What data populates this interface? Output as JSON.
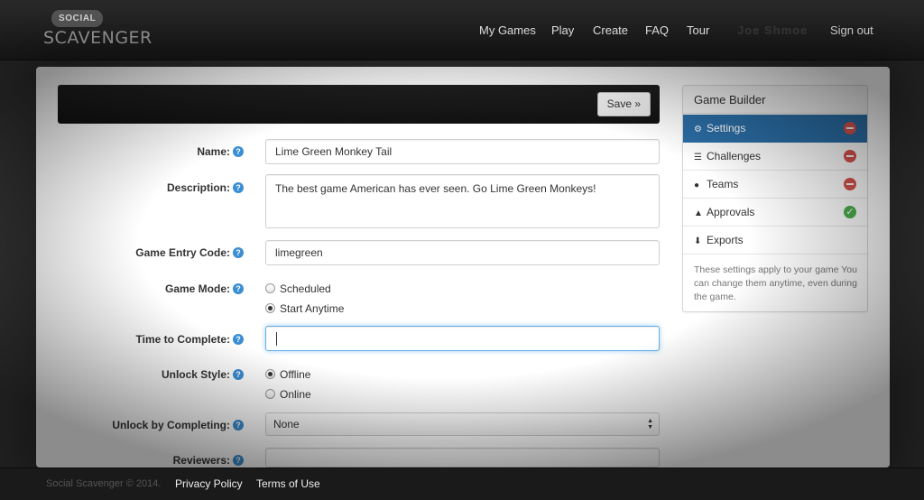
{
  "brand": {
    "social": "SOCIAL",
    "scavenger": "SCAVENGER"
  },
  "nav": {
    "items": [
      {
        "label": "My Games"
      },
      {
        "label": "Play"
      },
      {
        "label": "Create"
      },
      {
        "label": "FAQ"
      },
      {
        "label": "Tour"
      }
    ],
    "user": "Joe Shmoe",
    "signout": "Sign out"
  },
  "toolbar": {
    "save_label": "Save »"
  },
  "form": {
    "name": {
      "label": "Name:",
      "value": "Lime Green Monkey Tail"
    },
    "description": {
      "label": "Description:",
      "value": "The best game American has ever seen. Go Lime Green Monkeys!"
    },
    "entry_code": {
      "label": "Game Entry Code:",
      "value": "limegreen"
    },
    "game_mode": {
      "label": "Game Mode:",
      "options": [
        "Scheduled",
        "Start Anytime"
      ],
      "selected": "Start Anytime"
    },
    "time_to_complete": {
      "label": "Time to Complete:",
      "value": ""
    },
    "unlock_style": {
      "label": "Unlock Style:",
      "options": [
        "Offline",
        "Online"
      ],
      "selected": "Offline"
    },
    "unlock_by_completing": {
      "label": "Unlock by Completing:",
      "value": "None"
    },
    "reviewers": {
      "label": "Reviewers:",
      "value": ""
    },
    "help_glyph": "?"
  },
  "sidebar": {
    "title": "Game Builder",
    "items": [
      {
        "label": "Settings",
        "icon": "gear-icon",
        "status": "incomplete",
        "active": true
      },
      {
        "label": "Challenges",
        "icon": "list-icon",
        "status": "incomplete"
      },
      {
        "label": "Teams",
        "icon": "user-icon",
        "status": "incomplete"
      },
      {
        "label": "Approvals",
        "icon": "thumbs-up-icon",
        "status": "complete"
      },
      {
        "label": "Exports",
        "icon": "download-icon",
        "status": "none"
      }
    ],
    "note": "These settings apply to your game You can change them anytime, even during the game."
  },
  "footer": {
    "copyright": "Social Scavenger © 2014.",
    "links": [
      {
        "label": "Privacy Policy"
      },
      {
        "label": "Terms of Use"
      }
    ]
  },
  "colors": {
    "accent": "#2b6ea6",
    "danger": "#d9534f",
    "success": "#4cae4c",
    "help": "#3a8ed3"
  }
}
